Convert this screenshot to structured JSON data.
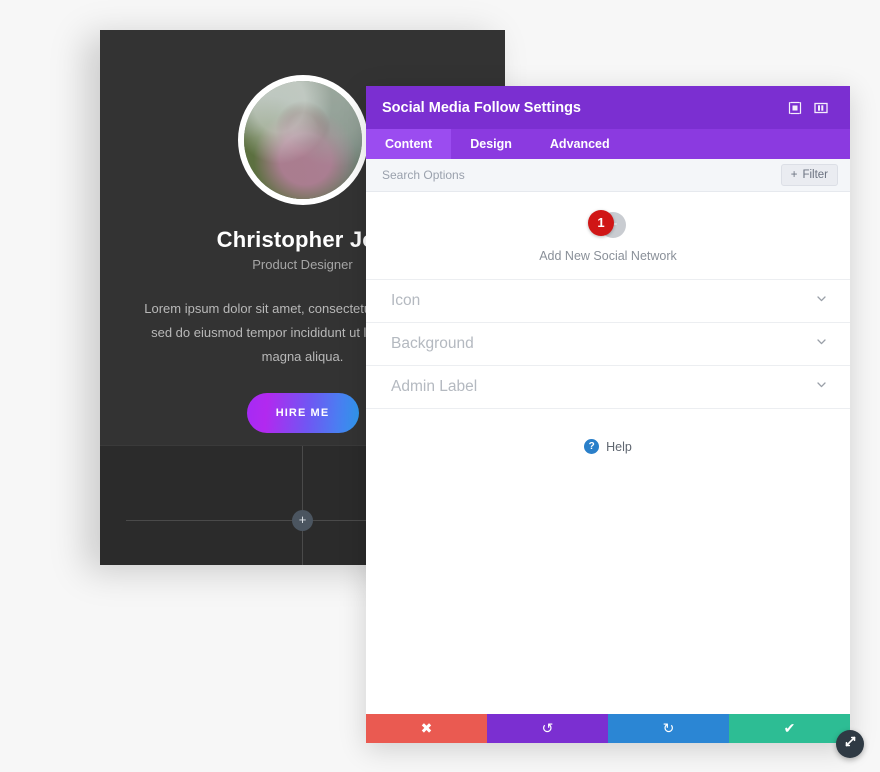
{
  "profile": {
    "name": "Christopher Joe",
    "role": "Product Designer",
    "bio": "Lorem ipsum dolor sit amet, consectetur adipiscing elit, sed do eiusmod tempor incididunt ut labore et dolore magna aliqua.",
    "cta_label": "HIRE ME",
    "avatar_icon": "user-avatar-photo",
    "add_module_icon": "plus-icon"
  },
  "modal": {
    "title": "Social Media Follow Settings",
    "header_icons": [
      {
        "name": "fullscreen-icon",
        "glyph": "expand"
      },
      {
        "name": "split-view-icon",
        "glyph": "columns"
      }
    ],
    "tabs": [
      {
        "label": "Content",
        "active": true
      },
      {
        "label": "Design",
        "active": false
      },
      {
        "label": "Advanced",
        "active": false
      }
    ],
    "search": {
      "placeholder": "Search Options",
      "value": "",
      "icon": "search-icon"
    },
    "filter": {
      "label": "Filter",
      "icon": "plus-icon"
    },
    "add_network": {
      "label": "Add New Social Network",
      "count": "1",
      "plus_glyph": "+",
      "badge_color": "#d01616",
      "button_color": "#c9ccd1"
    },
    "sections": [
      {
        "label": "Icon",
        "icon": "chevron-down-icon"
      },
      {
        "label": "Background",
        "icon": "chevron-down-icon"
      },
      {
        "label": "Admin Label",
        "icon": "chevron-down-icon"
      }
    ],
    "help": {
      "label": "Help",
      "icon": "question-mark-icon",
      "icon_color": "#2a7fc9"
    },
    "footer_buttons": [
      {
        "name": "cancel-button",
        "icon": "close-x-icon",
        "glyph": "✖",
        "color": "#ea5a51"
      },
      {
        "name": "undo-button",
        "icon": "undo-arrow-icon",
        "glyph": "↺",
        "color": "#7b2fd1"
      },
      {
        "name": "redo-button",
        "icon": "redo-arrow-icon",
        "glyph": "↻",
        "color": "#2b86d4"
      },
      {
        "name": "save-button",
        "icon": "checkmark-icon",
        "glyph": "✔",
        "color": "#2dbd94"
      }
    ],
    "resize_handle": {
      "icon": "resize-diagonal-icon"
    },
    "accent_color": "#7b2fd1",
    "tabbar_color": "#8b3ae0"
  }
}
